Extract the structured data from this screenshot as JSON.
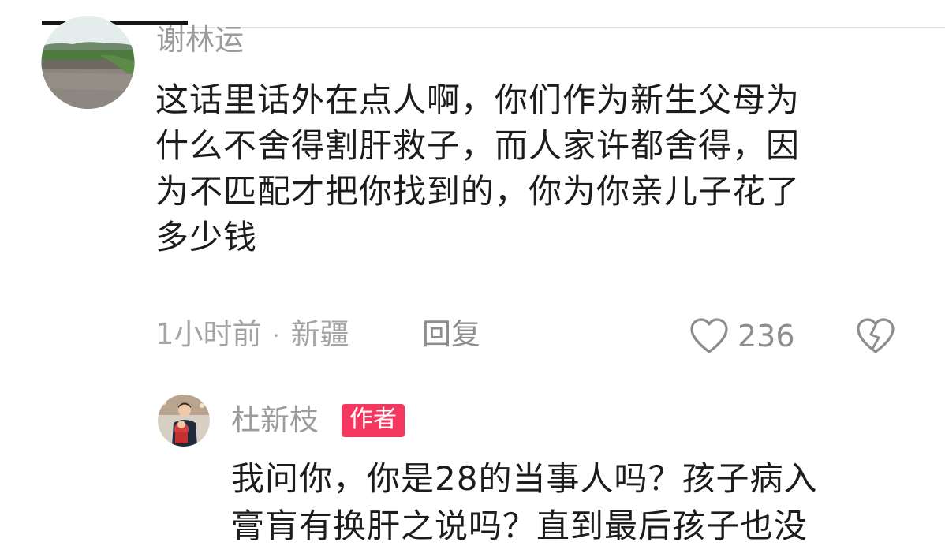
{
  "comment": {
    "username": "谢林运",
    "lines": [
      "这话里话外在点人啊，你们作为新生父母为",
      "什么不舍得割肝救子，而人家许都舍得，因",
      "为不匹配才把你找到的，你为你亲儿子花了",
      "多少钱"
    ],
    "time": "1小时前",
    "separator": "·",
    "location": "新疆",
    "reply_label": "回复",
    "like_count": "236",
    "avatar_icon": "landscape-avatar",
    "like_icon": "heart-outline-icon",
    "dislike_icon": "broken-heart-icon"
  },
  "reply": {
    "username": "杜新枝",
    "badge": "作者",
    "badge_color": "#f3375e",
    "avatar_icon": "child-photo-avatar",
    "lines": [
      "我问你，你是28的当事人吗？孩子病入",
      "膏肓有换肝之说吗？直到最后孩子也没"
    ]
  },
  "colors": {
    "text": "#1c1c1c",
    "muted": "#9b9b9b",
    "background": "#ffffff"
  }
}
